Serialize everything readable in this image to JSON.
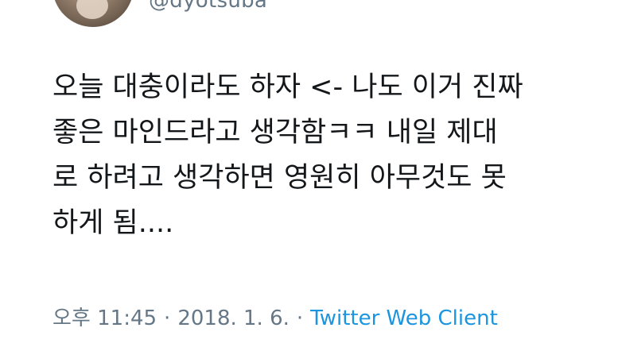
{
  "tweet": {
    "handle": "@dyotsuba",
    "text_lines": [
      "오늘 대충이라도 하자 <- 나도 이거 진짜",
      "좋은 마인드라고 생각함ㅋㅋ 내일 제대",
      "로 하려고 생각하면 영원히 아무것도 못",
      "하게 됨...."
    ],
    "time": "오후 11:45",
    "separator": "·",
    "date": "2018. 1. 6.",
    "source": "Twitter Web Client"
  },
  "colors": {
    "text": "#14171a",
    "secondary": "#657786",
    "link": "#1b95e0",
    "background": "#ffffff"
  }
}
